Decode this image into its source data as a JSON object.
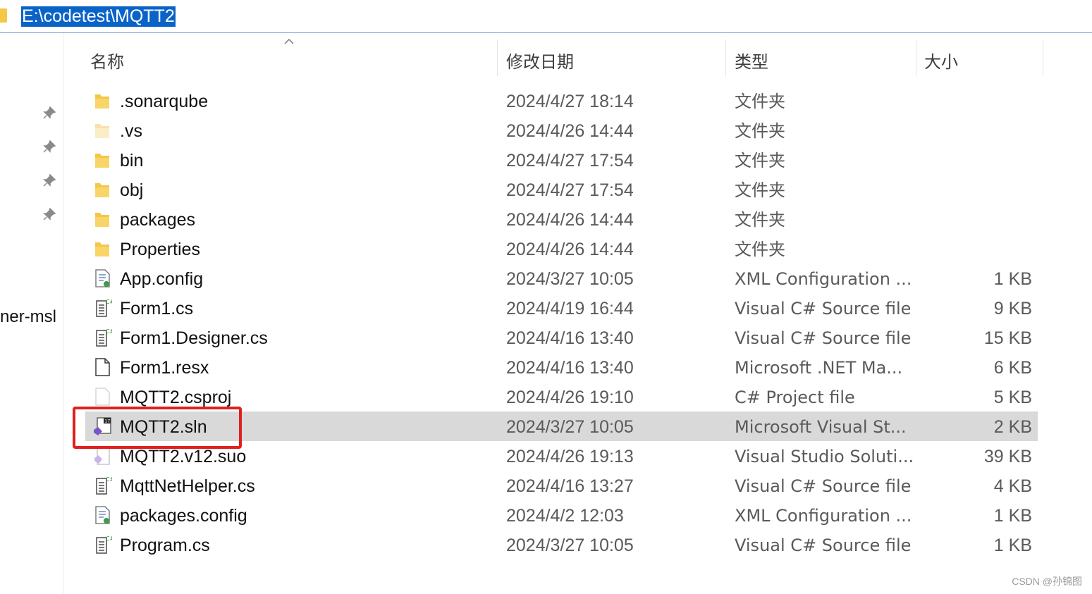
{
  "address": {
    "path": "E:\\codetest\\MQTT2"
  },
  "nav": {
    "partial_item": "ner-msl"
  },
  "columns": {
    "name": "名称",
    "date": "修改日期",
    "type": "类型",
    "size": "大小"
  },
  "files": [
    {
      "name": ".sonarqube",
      "date": "2024/4/27 18:14",
      "type": "文件夹",
      "size": "",
      "icon": "folder-icon"
    },
    {
      "name": ".vs",
      "date": "2024/4/26 14:44",
      "type": "文件夹",
      "size": "",
      "icon": "folder-light-icon"
    },
    {
      "name": "bin",
      "date": "2024/4/27 17:54",
      "type": "文件夹",
      "size": "",
      "icon": "folder-icon"
    },
    {
      "name": "obj",
      "date": "2024/4/27 17:54",
      "type": "文件夹",
      "size": "",
      "icon": "folder-icon"
    },
    {
      "name": "packages",
      "date": "2024/4/26 14:44",
      "type": "文件夹",
      "size": "",
      "icon": "folder-icon"
    },
    {
      "name": "Properties",
      "date": "2024/4/26 14:44",
      "type": "文件夹",
      "size": "",
      "icon": "folder-icon"
    },
    {
      "name": "App.config",
      "date": "2024/3/27 10:05",
      "type": "XML Configuration ...",
      "size": "1 KB",
      "icon": "config-file-icon"
    },
    {
      "name": "Form1.cs",
      "date": "2024/4/19 16:44",
      "type": "Visual C# Source file",
      "size": "9 KB",
      "icon": "csharp-file-icon"
    },
    {
      "name": "Form1.Designer.cs",
      "date": "2024/4/16 13:40",
      "type": "Visual C# Source file",
      "size": "15 KB",
      "icon": "csharp-file-icon"
    },
    {
      "name": "Form1.resx",
      "date": "2024/4/16 13:40",
      "type": "Microsoft .NET Ma...",
      "size": "6 KB",
      "icon": "resx-file-icon"
    },
    {
      "name": "MQTT2.csproj",
      "date": "2024/4/26 19:10",
      "type": "C# Project file",
      "size": "5 KB",
      "icon": "blank-file-icon"
    },
    {
      "name": "MQTT2.sln",
      "date": "2024/3/27 10:05",
      "type": "Microsoft Visual St...",
      "size": "2 KB",
      "icon": "vs-solution-icon",
      "selected": true
    },
    {
      "name": "MQTT2.v12.suo",
      "date": "2024/4/26 19:13",
      "type": "Visual Studio Soluti...",
      "size": "39 KB",
      "icon": "vs-suo-icon"
    },
    {
      "name": "MqttNetHelper.cs",
      "date": "2024/4/16 13:27",
      "type": "Visual C# Source file",
      "size": "4 KB",
      "icon": "csharp-file-icon"
    },
    {
      "name": "packages.config",
      "date": "2024/4/2 12:03",
      "type": "XML Configuration ...",
      "size": "1 KB",
      "icon": "config-file-icon"
    },
    {
      "name": "Program.cs",
      "date": "2024/3/27 10:05",
      "type": "Visual C# Source file",
      "size": "1 KB",
      "icon": "csharp-file-icon"
    }
  ],
  "watermark": "CSDN @孙锦图",
  "colors": {
    "selection": "#d9d9d9",
    "highlight_border": "#e02020",
    "address_selection": "#0a64c8",
    "folder": "#f4c744"
  }
}
